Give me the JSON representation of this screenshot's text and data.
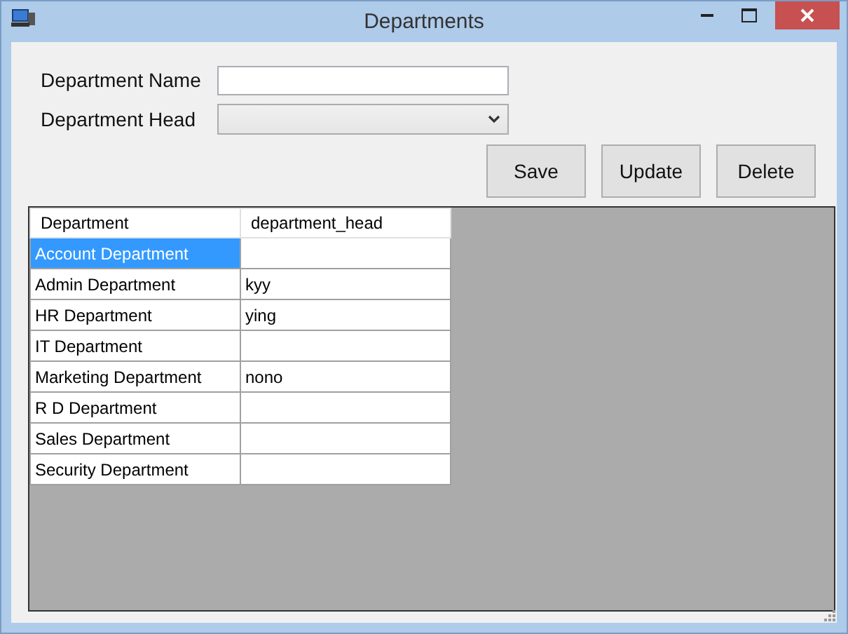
{
  "window": {
    "title": "Departments"
  },
  "form": {
    "fields": [
      {
        "label": "Department Name",
        "kind": "text"
      },
      {
        "label": "Department Head",
        "kind": "select"
      }
    ],
    "buttons": [
      "Save",
      "Update",
      "Delete"
    ]
  },
  "grid": {
    "columns": [
      "Department",
      "department_head"
    ],
    "rows": [
      {
        "cells": [
          "Account Department",
          ""
        ],
        "selected": true
      },
      {
        "cells": [
          "Admin Department",
          "kyy"
        ],
        "selected": false
      },
      {
        "cells": [
          "HR Department",
          "ying"
        ],
        "selected": false
      },
      {
        "cells": [
          "IT Department",
          ""
        ],
        "selected": false
      },
      {
        "cells": [
          "Marketing Department",
          "nono"
        ],
        "selected": false
      },
      {
        "cells": [
          "R D Department",
          ""
        ],
        "selected": false
      },
      {
        "cells": [
          "Sales Department",
          ""
        ],
        "selected": false
      },
      {
        "cells": [
          "Security Department",
          ""
        ],
        "selected": false
      }
    ]
  }
}
